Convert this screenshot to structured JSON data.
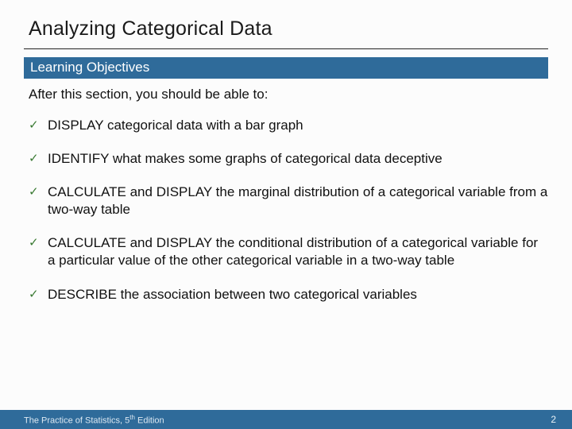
{
  "title": "Analyzing Categorical Data",
  "subtitle": "Learning Objectives",
  "intro": "After this section, you should be able to:",
  "objectives": [
    "DISPLAY categorical data with a bar graph",
    "IDENTIFY what makes some graphs of categorical data deceptive",
    "CALCULATE and DISPLAY the marginal distribution of a categorical variable from a two-way table",
    "CALCULATE and DISPLAY the conditional distribution of a categorical variable for a particular value of the other categorical variable in a two-way table",
    "DESCRIBE the association between two categorical variables"
  ],
  "footer": {
    "book_prefix": "The Practice of Statistics, 5",
    "book_suffix": " Edition",
    "ordinal": "th",
    "page": "2"
  }
}
